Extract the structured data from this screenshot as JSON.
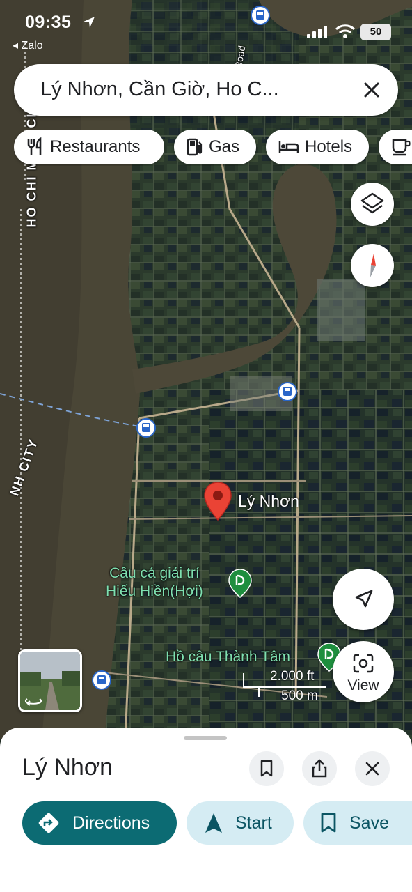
{
  "status_bar": {
    "time": "09:35",
    "back_app": "Zalo",
    "battery": "50"
  },
  "search": {
    "query": "Lý Nhơn, Cần Giờ, Ho C..."
  },
  "chips": [
    {
      "label": "Restaurants",
      "icon": "restaurant-icon"
    },
    {
      "label": "Gas",
      "icon": "gas-station-icon"
    },
    {
      "label": "Hotels",
      "icon": "hotel-bed-icon"
    },
    {
      "label": "",
      "icon": "cafe-cup-icon"
    }
  ],
  "map": {
    "place_label": "Lý Nhơn",
    "poi_1": {
      "line1": "Câu cá giải trí",
      "line2": "Hiếu Hiền(Hợi)"
    },
    "poi_2": "Hồ câu Thành Tâm",
    "scale_ft": "2.000 ft",
    "scale_m": "500 m",
    "view_button": "View",
    "city_label_top": "HO CHI MINH CITY",
    "city_label_left": "NH CITY",
    "road_label": "Road"
  },
  "sheet": {
    "title": "Lý Nhơn",
    "directions": "Directions",
    "start": "Start",
    "save": "Save"
  },
  "colors": {
    "accent": "#0c6b73",
    "secondary_bg": "#d5ecf3",
    "pin": "#ea4335",
    "poi_green": "#1e8e3e"
  }
}
